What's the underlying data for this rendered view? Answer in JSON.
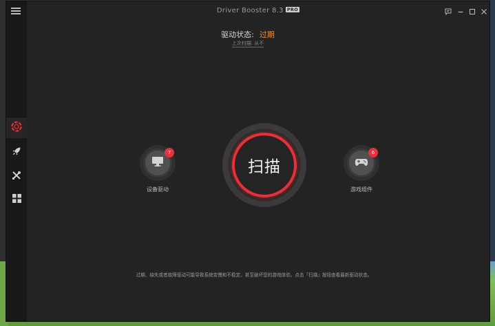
{
  "window": {
    "title": "Driver Booster 8.3",
    "pro_badge": "PRO"
  },
  "status": {
    "label": "驱动状态:",
    "value": "过期",
    "value_color": "#ff8a1f",
    "last_scan": "上次扫描: 从不"
  },
  "device_drivers": {
    "label": "设备驱动",
    "count": "7",
    "icon": "monitor-icon"
  },
  "game_components": {
    "label": "游戏组件",
    "count": "6",
    "icon": "gamepad-icon"
  },
  "scan_button": {
    "label": "扫描",
    "accent": "#ef2c33"
  },
  "sidebar": {
    "items": [
      {
        "icon": "lifebuoy-icon",
        "active": true
      },
      {
        "icon": "rocket-icon",
        "active": false
      },
      {
        "icon": "tools-icon",
        "active": false
      },
      {
        "icon": "grid-icon",
        "active": false
      }
    ]
  },
  "footer": {
    "note": "过期、缺失或者故障驱动可能导致系统变慢和不稳定，甚至破坏您的游戏体验。点击「扫描」按钮查看最新驱动状态。"
  }
}
